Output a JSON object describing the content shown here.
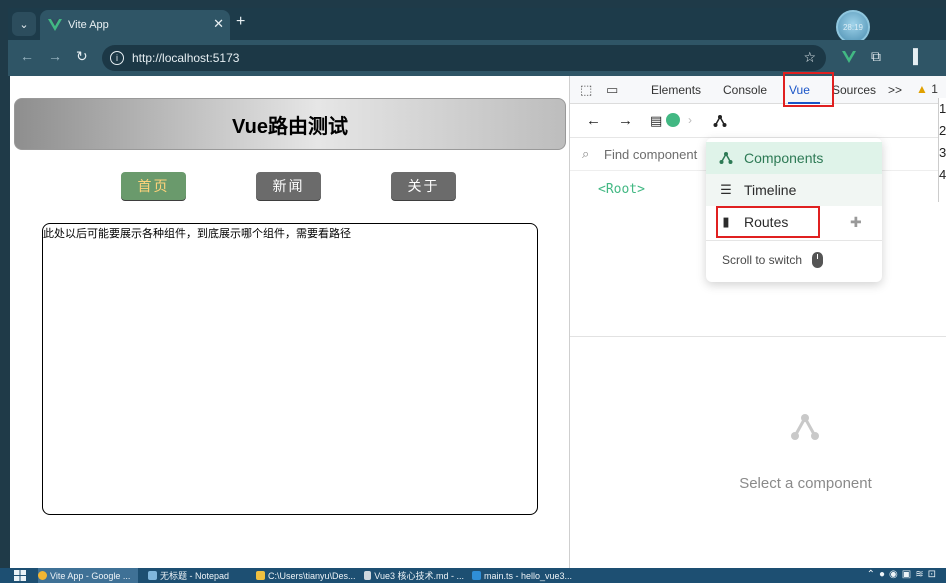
{
  "browser": {
    "tab_title": "Vite App",
    "close_glyph": "✕",
    "new_tab_glyph": "+",
    "tab_menu_glyph": "⌄",
    "profile_text": "28:19",
    "url_prefix": "http://",
    "url_host": "localhost",
    "url_suffix": ":5173",
    "vue_logo_color": "#42b883"
  },
  "page": {
    "title": "Vue路由测试",
    "nav": [
      {
        "label": "首页",
        "active": true
      },
      {
        "label": "新闻",
        "active": false
      },
      {
        "label": "关于",
        "active": false
      }
    ],
    "content_text": "此处以后可能要展示各种组件，到底展示哪个组件，需要看路径"
  },
  "devtools": {
    "tabs": [
      "Elements",
      "Console",
      "Vue",
      "Sources",
      ">>"
    ],
    "active_tab": "Vue",
    "warning_count": "1",
    "find_placeholder": "Find component",
    "root_node": "<Root>",
    "menu": {
      "items": [
        {
          "label": "Components",
          "icon": "components-icon"
        },
        {
          "label": "Timeline",
          "icon": "timeline-icon"
        },
        {
          "label": "Routes",
          "icon": "routes-icon"
        }
      ],
      "scroll_hint": "Scroll to switch"
    },
    "empty_state": "Select a component",
    "side_numbers": [
      "1",
      "2",
      "3",
      "4"
    ]
  },
  "taskbar": {
    "items": [
      "Vite App - Google ...",
      "无标题 - Notepad",
      "C:\\Users\\tianyu\\Des...",
      "Vue3 核心技术.md - ...",
      "main.ts - hello_vue3..."
    ]
  },
  "colors": {
    "accent_red": "#e02020",
    "vue_green": "#42b883",
    "active_nav_bg": "#6a9a6c",
    "active_nav_text": "#ffd27a"
  }
}
